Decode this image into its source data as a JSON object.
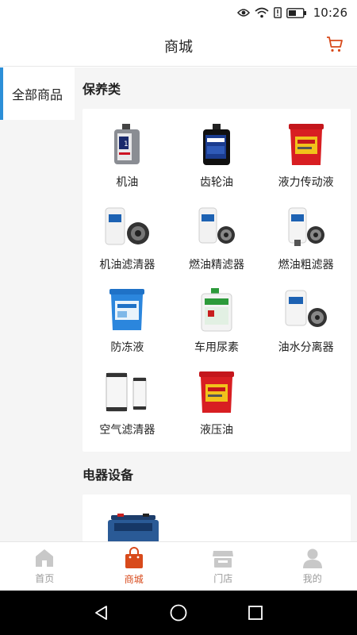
{
  "status_bar": {
    "time": "10:26"
  },
  "header": {
    "title": "商城"
  },
  "sidebar": {
    "items": [
      {
        "label": "全部商品",
        "selected": true
      }
    ]
  },
  "sections": [
    {
      "title": "保养类",
      "products": [
        {
          "name": "机油",
          "icon": "oil-bottle-icon"
        },
        {
          "name": "齿轮油",
          "icon": "gear-oil-bottle-icon"
        },
        {
          "name": "液力传动液",
          "icon": "red-bucket-icon"
        },
        {
          "name": "机油滤清器",
          "icon": "oil-filter-icon"
        },
        {
          "name": "燃油精滤器",
          "icon": "fuel-fine-filter-icon"
        },
        {
          "name": "燃油粗滤器",
          "icon": "fuel-coarse-filter-icon"
        },
        {
          "name": "防冻液",
          "icon": "blue-bucket-icon"
        },
        {
          "name": "车用尿素",
          "icon": "urea-jug-icon"
        },
        {
          "name": "油水分离器",
          "icon": "oil-water-separator-icon"
        },
        {
          "name": "空气滤清器",
          "icon": "air-filter-icon"
        },
        {
          "name": "液压油",
          "icon": "red-bucket-icon"
        }
      ]
    },
    {
      "title": "电器设备",
      "products": [
        {
          "name": "",
          "icon": "battery-icon"
        }
      ]
    }
  ],
  "tabbar": {
    "tabs": [
      {
        "label": "首页",
        "icon": "home-icon",
        "active": false
      },
      {
        "label": "商城",
        "icon": "shopping-bag-icon",
        "active": true
      },
      {
        "label": "门店",
        "icon": "store-icon",
        "active": false
      },
      {
        "label": "我的",
        "icon": "person-icon",
        "active": false
      }
    ]
  },
  "colors": {
    "accent": "#d84a1b",
    "sidebar_indicator": "#2c8fd8",
    "background": "#f5f5f5"
  }
}
